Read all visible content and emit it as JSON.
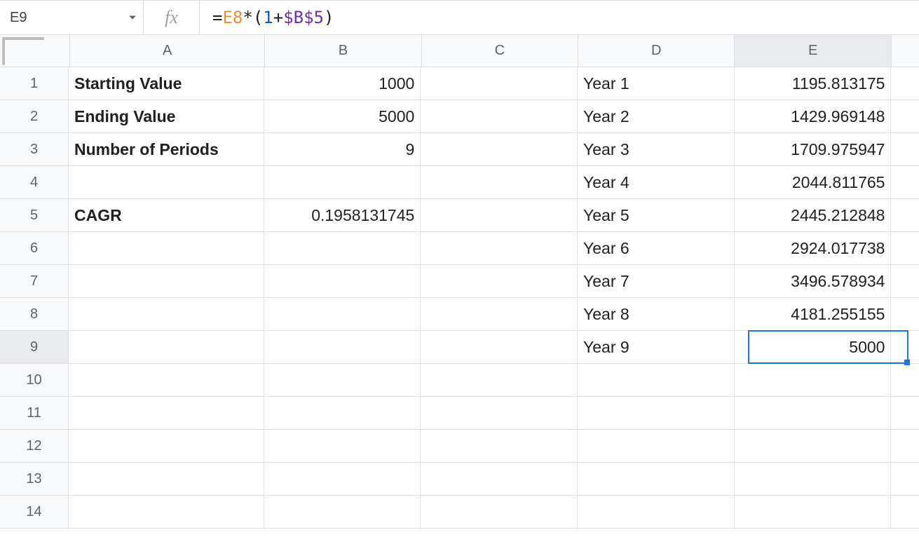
{
  "nameBox": "E9",
  "fxLabel": "fx",
  "formula": {
    "eq": "=",
    "ref1": "E8",
    "op1": "*",
    "paren_open": "(",
    "num": "1",
    "op2": "+",
    "ref2": "$B$5",
    "paren_close": ")"
  },
  "columns": [
    "A",
    "B",
    "C",
    "D",
    "E"
  ],
  "selectedColumn": "E",
  "rowCount": 14,
  "selectedRow": 9,
  "selectedCell": "E9",
  "cells": {
    "A1": {
      "text": "Starting Value",
      "bold": true,
      "align": "left"
    },
    "B1": {
      "text": "1000",
      "align": "right"
    },
    "D1": {
      "text": "Year 1",
      "align": "left"
    },
    "E1": {
      "text": "1195.813175",
      "align": "right"
    },
    "A2": {
      "text": "Ending Value",
      "bold": true,
      "align": "left"
    },
    "B2": {
      "text": "5000",
      "align": "right"
    },
    "D2": {
      "text": "Year 2",
      "align": "left"
    },
    "E2": {
      "text": "1429.969148",
      "align": "right"
    },
    "A3": {
      "text": "Number of Periods",
      "bold": true,
      "align": "left"
    },
    "B3": {
      "text": "9",
      "align": "right"
    },
    "D3": {
      "text": "Year 3",
      "align": "left"
    },
    "E3": {
      "text": "1709.975947",
      "align": "right"
    },
    "D4": {
      "text": "Year 4",
      "align": "left"
    },
    "E4": {
      "text": "2044.811765",
      "align": "right"
    },
    "A5": {
      "text": "CAGR",
      "bold": true,
      "align": "left"
    },
    "B5": {
      "text": "0.1958131745",
      "align": "right"
    },
    "D5": {
      "text": "Year 5",
      "align": "left"
    },
    "E5": {
      "text": "2445.212848",
      "align": "right"
    },
    "D6": {
      "text": "Year 6",
      "align": "left"
    },
    "E6": {
      "text": "2924.017738",
      "align": "right"
    },
    "D7": {
      "text": "Year 7",
      "align": "left"
    },
    "E7": {
      "text": "3496.578934",
      "align": "right"
    },
    "D8": {
      "text": "Year 8",
      "align": "left"
    },
    "E8": {
      "text": "4181.255155",
      "align": "right"
    },
    "D9": {
      "text": "Year 9",
      "align": "left"
    },
    "E9": {
      "text": "5000",
      "align": "right"
    }
  }
}
